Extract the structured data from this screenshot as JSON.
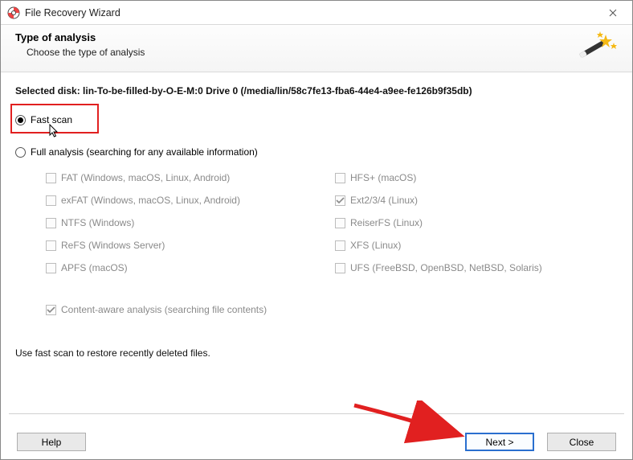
{
  "window": {
    "title": "File Recovery Wizard"
  },
  "header": {
    "title": "Type of analysis",
    "subtitle": "Choose the type of analysis"
  },
  "disk": {
    "prefix": "Selected disk: ",
    "text": "lin-To-be-filled-by-O-E-M:0 Drive 0 (/media/lin/58c7fe13-fba6-44e4-a9ee-fe126b9f35db)"
  },
  "options": {
    "fast": {
      "label": "Fast scan",
      "selected": true
    },
    "full": {
      "label": "Full analysis (searching for any available information)",
      "selected": false
    }
  },
  "fs": {
    "left": [
      {
        "label": "FAT (Windows, macOS, Linux, Android)",
        "checked": false
      },
      {
        "label": "exFAT (Windows, macOS, Linux, Android)",
        "checked": false
      },
      {
        "label": "NTFS (Windows)",
        "checked": false
      },
      {
        "label": "ReFS (Windows Server)",
        "checked": false
      },
      {
        "label": "APFS (macOS)",
        "checked": false
      }
    ],
    "right": [
      {
        "label": "HFS+ (macOS)",
        "checked": false
      },
      {
        "label": "Ext2/3/4 (Linux)",
        "checked": true
      },
      {
        "label": "ReiserFS (Linux)",
        "checked": false
      },
      {
        "label": "XFS (Linux)",
        "checked": false
      },
      {
        "label": "UFS (FreeBSD, OpenBSD, NetBSD, Solaris)",
        "checked": false
      }
    ]
  },
  "content_aware": {
    "label": "Content-aware analysis (searching file contents)",
    "checked": true
  },
  "hint": "Use fast scan to restore recently deleted files.",
  "buttons": {
    "help": "Help",
    "next": "Next >",
    "close": "Close"
  }
}
